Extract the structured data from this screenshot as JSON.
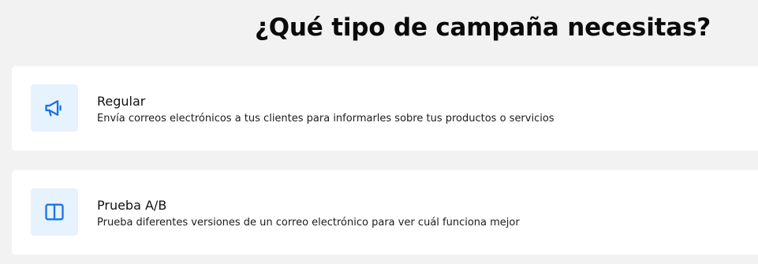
{
  "header": {
    "title": "¿Qué tipo de campaña necesitas?"
  },
  "campaign_types": [
    {
      "title": "Regular",
      "description": "Envía correos electrónicos a tus clientes para informarles sobre tus productos o servicios",
      "icon": "megaphone-icon"
    },
    {
      "title": "Prueba A/B",
      "description": "Prueba diferentes versiones de un correo electrónico para ver cuál funciona mejor",
      "icon": "book-open-icon"
    }
  ],
  "colors": {
    "background": "#f2f2f2",
    "card": "#ffffff",
    "icon_bg": "#e6f3fe",
    "icon_stroke": "#1a73e8"
  }
}
